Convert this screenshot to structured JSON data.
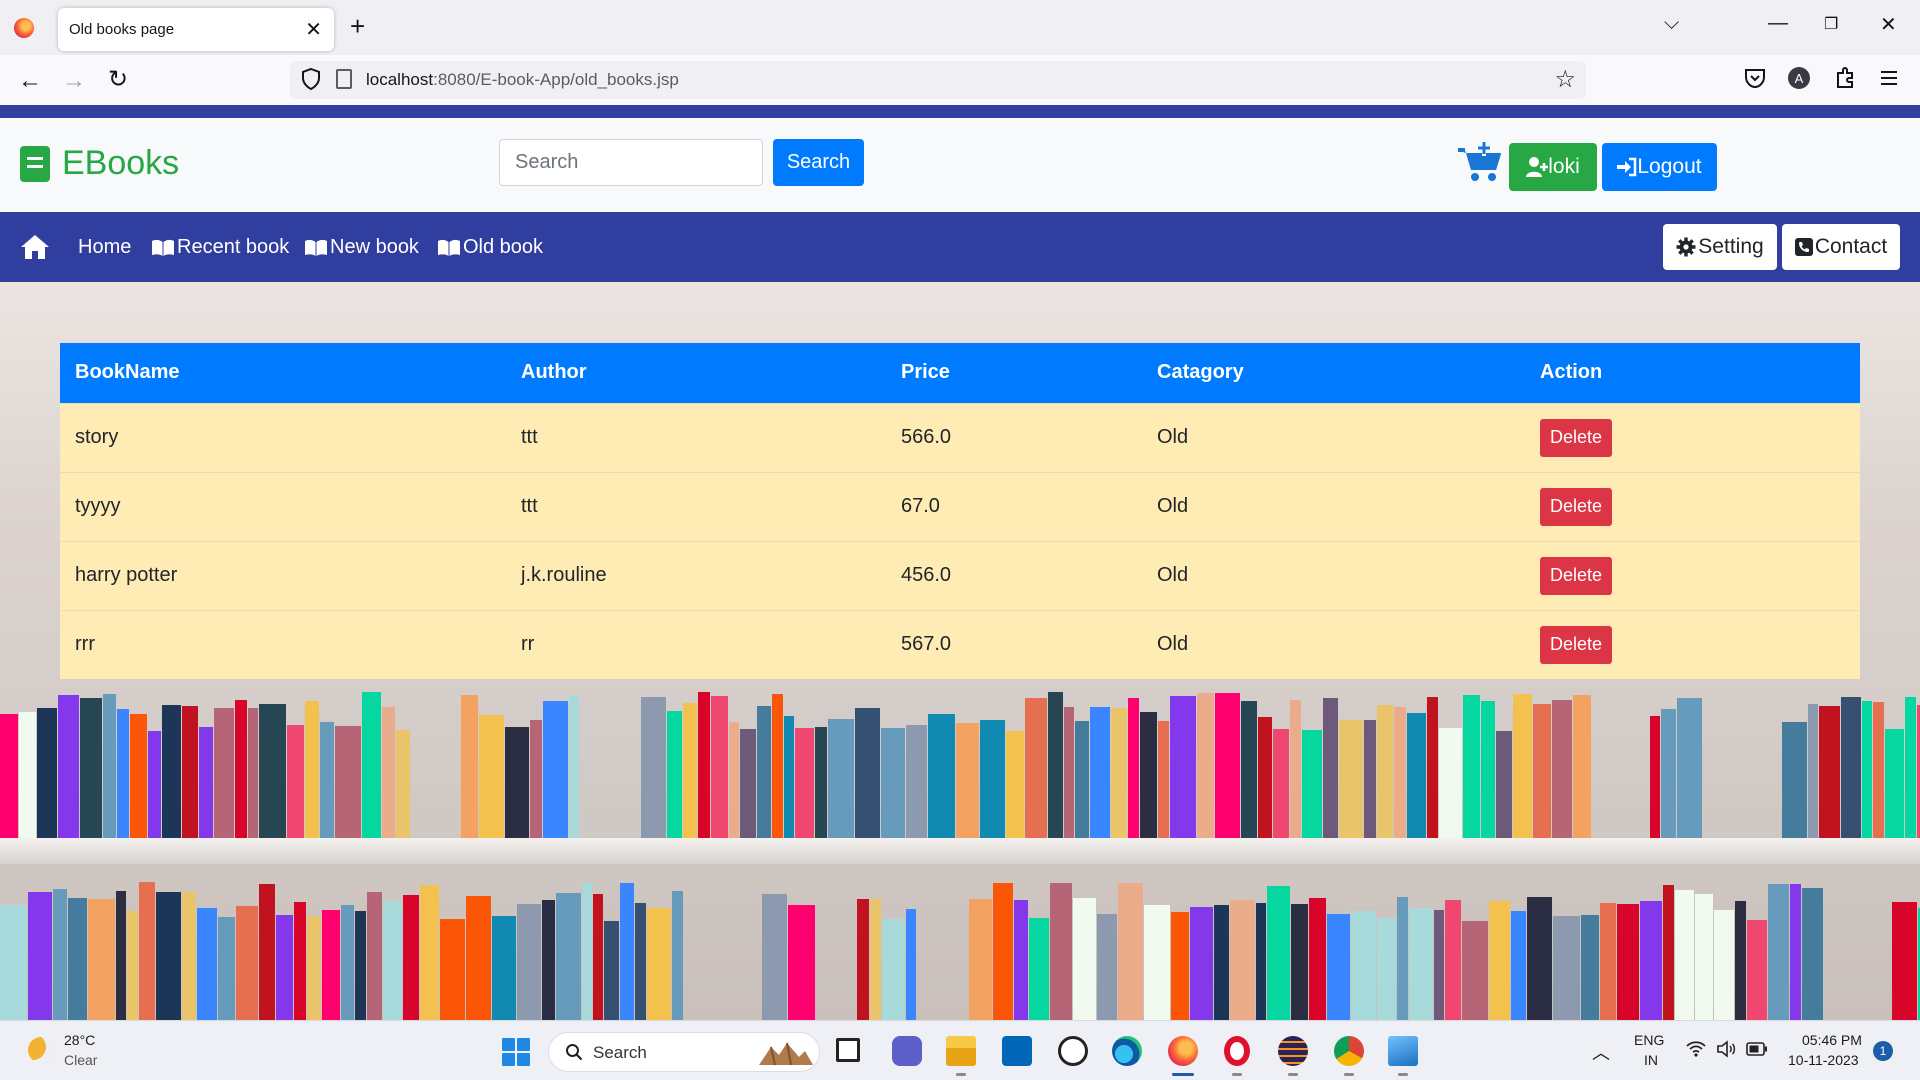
{
  "browser": {
    "tab_title": "Old books page",
    "url_host": "localhost",
    "url_rest": ":8080/E-book-App/old_books.jsp"
  },
  "header": {
    "brand": "EBooks",
    "search_placeholder": "Search",
    "search_button": "Search",
    "user_label": "loki",
    "logout_label": "Logout"
  },
  "nav": {
    "home": "Home",
    "recent": "Recent book",
    "new": "New book",
    "old": "Old book",
    "setting": "Setting",
    "contact": "Contact"
  },
  "table": {
    "headers": [
      "BookName",
      "Author",
      "Price",
      "Catagory",
      "Action"
    ],
    "rows": [
      {
        "name": "story",
        "author": "ttt",
        "price": "566.0",
        "category": "Old",
        "action": "Delete"
      },
      {
        "name": "tyyyy",
        "author": "ttt",
        "price": "67.0",
        "category": "Old",
        "action": "Delete"
      },
      {
        "name": "harry potter",
        "author": "j.k.rouline",
        "price": "456.0",
        "category": "Old",
        "action": "Delete"
      },
      {
        "name": "rrr",
        "author": "rr",
        "price": "567.0",
        "category": "Old",
        "action": "Delete"
      }
    ]
  },
  "taskbar": {
    "weather_temp": "28°C",
    "weather_cond": "Clear",
    "search_text": "Search",
    "lang_top": "ENG",
    "lang_bottom": "IN",
    "time": "05:46 PM",
    "date": "10-11-2023",
    "notification_count": "1"
  },
  "colors": {
    "primary": "#007bff",
    "nav": "#303f9f",
    "success": "#28a745",
    "danger": "#dc3545",
    "row": "#ffecb5"
  }
}
